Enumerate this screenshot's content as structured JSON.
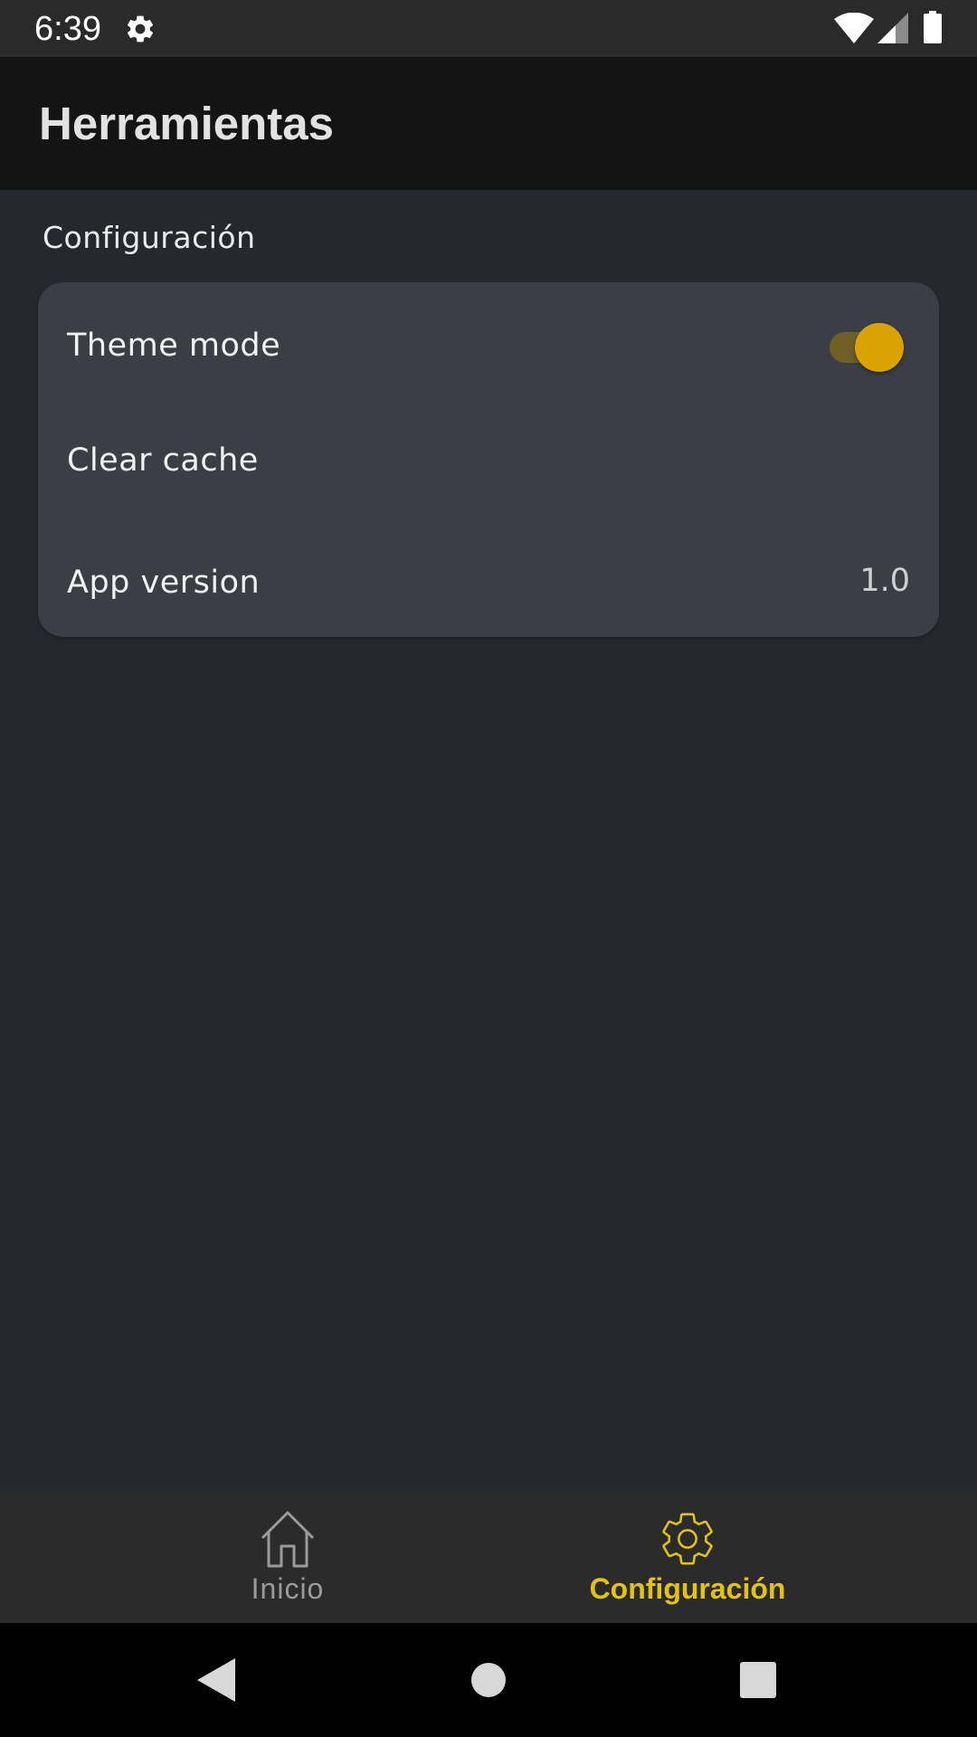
{
  "status_bar": {
    "time": "6:39",
    "icons": [
      "gear-icon",
      "wifi-icon",
      "signal-icon",
      "battery-icon"
    ]
  },
  "app_bar": {
    "title": "Herramientas"
  },
  "settings": {
    "section_title": "Configuración",
    "items": [
      {
        "label": "Theme mode",
        "control": "toggle",
        "toggle_on": true
      },
      {
        "label": "Clear cache"
      },
      {
        "label": "App version",
        "value": "1.0"
      }
    ]
  },
  "bottom_nav": {
    "items": [
      {
        "label": "Inicio",
        "icon": "home-icon",
        "active": false
      },
      {
        "label": "Configuración",
        "icon": "settings-gear-icon",
        "active": true
      }
    ]
  },
  "system_nav": {
    "buttons": [
      "back-icon",
      "home-circle-icon",
      "recents-icon"
    ]
  },
  "colors": {
    "background": "#25292e",
    "app_bar": "#141415",
    "card": "#3b3e44",
    "accent": "#e3c311",
    "toggle_thumb": "#d9a402",
    "toggle_track": "#6e5f24",
    "nav_inactive": "#9b9b9b"
  }
}
